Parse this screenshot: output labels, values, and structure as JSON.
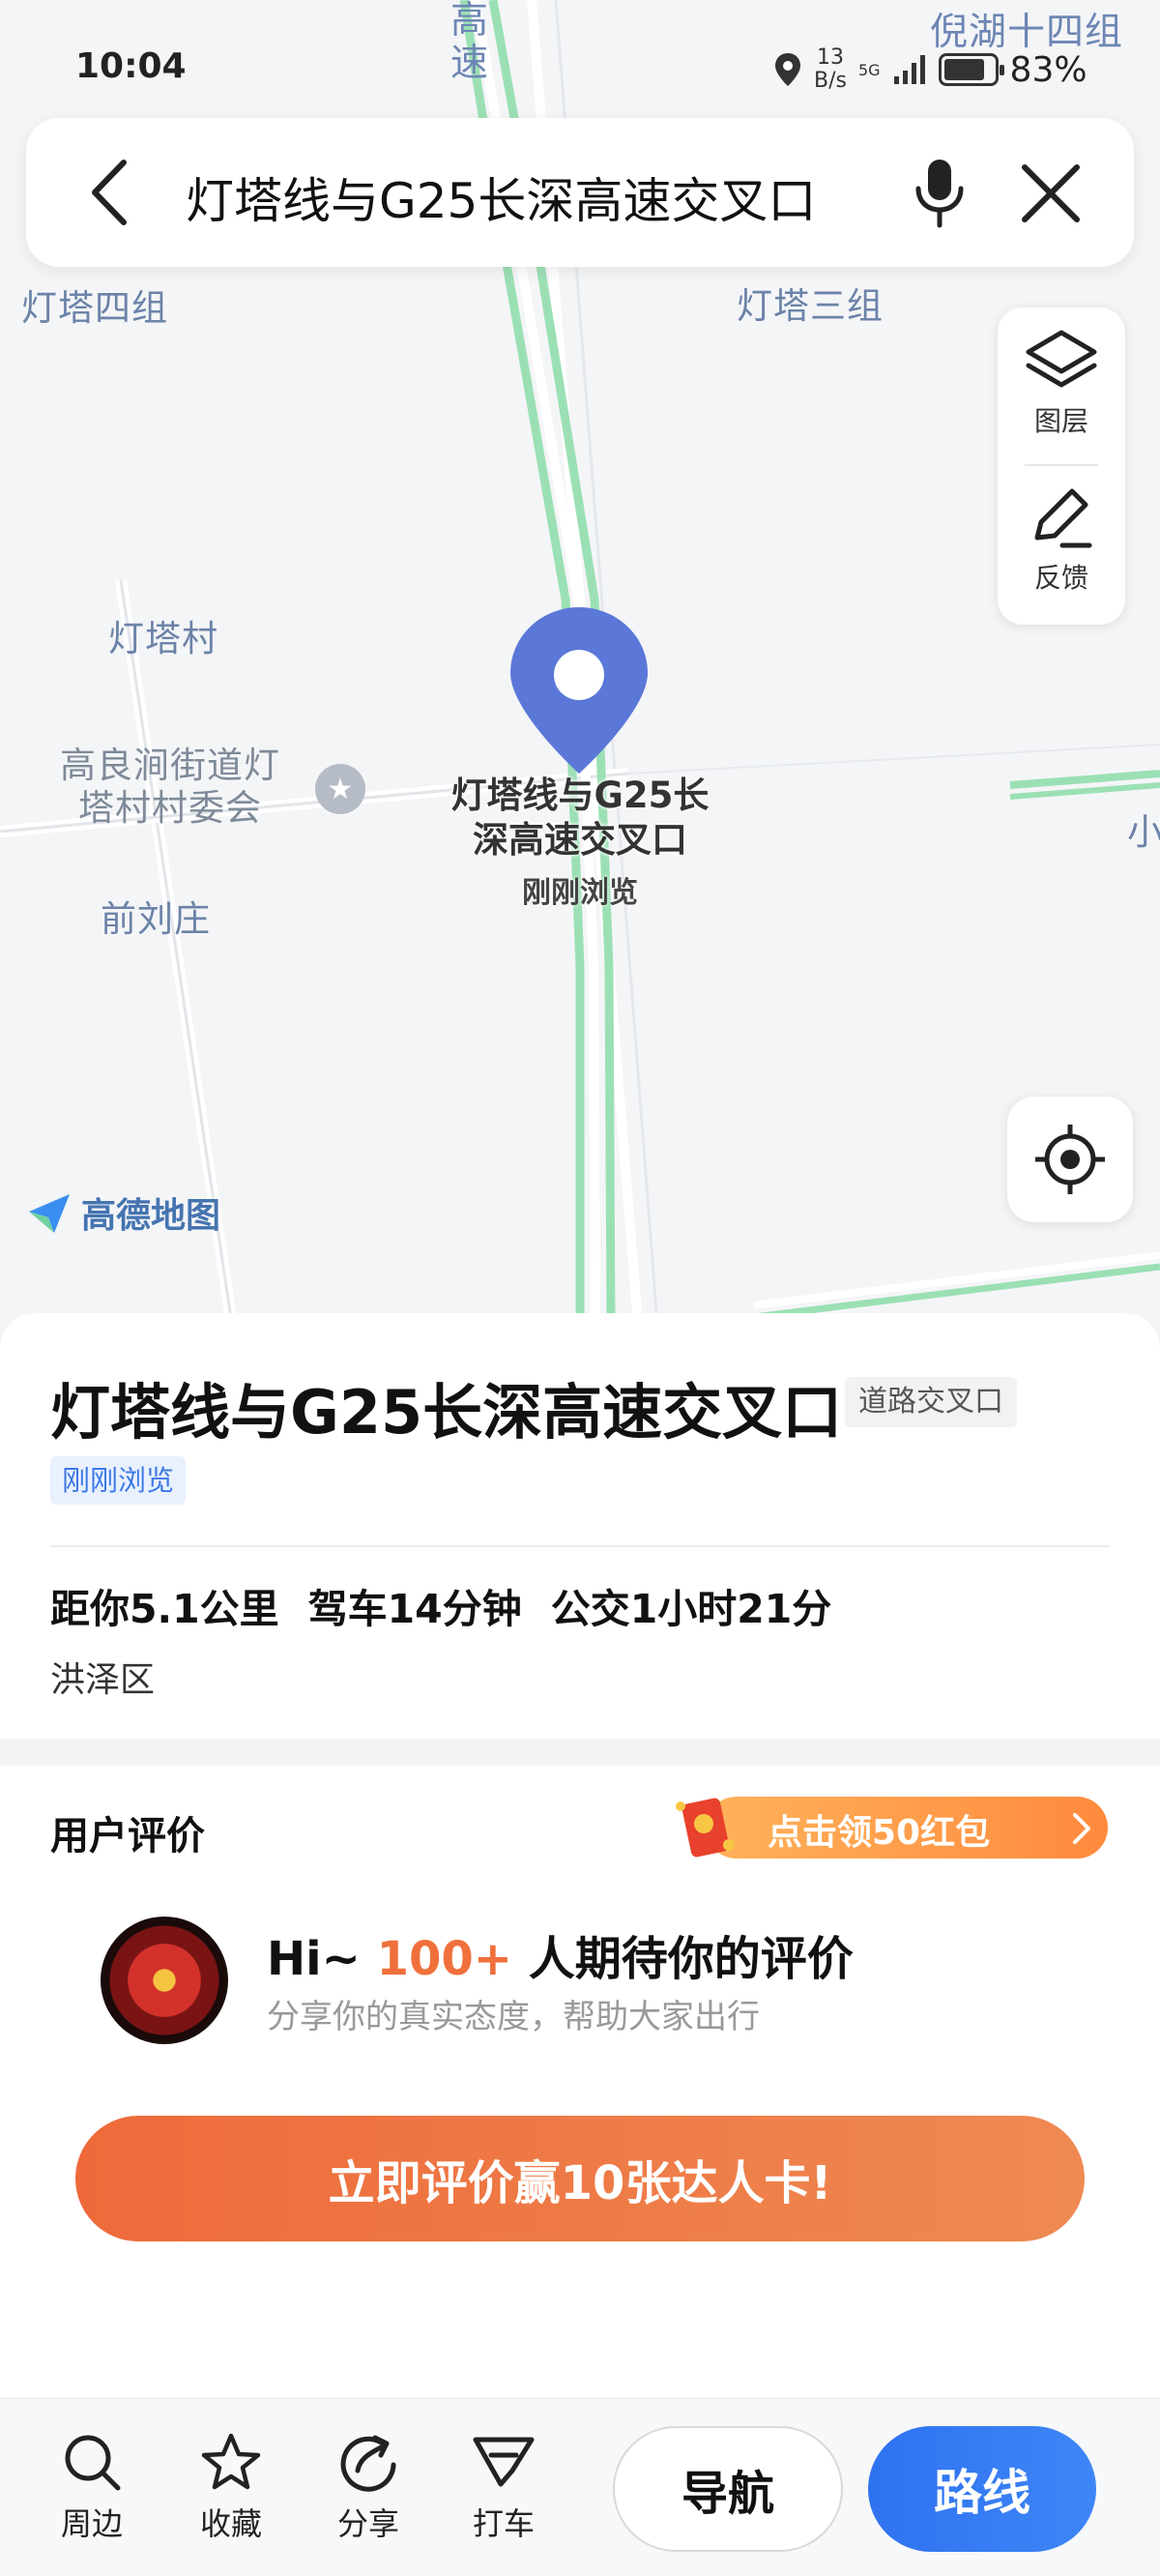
{
  "status_bar": {
    "time": "10:04",
    "net_speed_value": "13",
    "net_speed_unit": "B/s",
    "signal": "5G",
    "battery": "83%",
    "battery_level": 0.83
  },
  "search": {
    "query": "灯塔线与G25长深高速交叉口"
  },
  "map": {
    "labels": {
      "top_road": "高\n速",
      "ni_hu": "倪湖十四组",
      "dengta_4": "灯塔四组",
      "dengta_3": "灯塔三组",
      "dengta_village": "灯塔村",
      "committee": "高良涧街道灯\n塔村村委会",
      "qianliuzhuang": "前刘庄",
      "xiao": "小"
    },
    "poi_name": "灯塔线与G25长\n深高速交叉口",
    "poi_status": "刚刚浏览",
    "brand": "高德地图",
    "tools": {
      "layers": "图层",
      "feedback": "反馈"
    },
    "colors": {
      "road_green": "#9be0b4",
      "pin": "#5b78d8"
    }
  },
  "place": {
    "title": "灯塔线与G25长深高速交叉口",
    "type": "道路交叉口",
    "recent": "刚刚浏览",
    "distance": "距你5.1公里",
    "drive": "驾车14分钟",
    "transit": "公交1小时21分",
    "district": "洪泽区"
  },
  "reviews": {
    "title": "用户评价",
    "promo": "点击领50红包",
    "headline_prefix": "Hi~ ",
    "headline_count": "100+",
    "headline_suffix": " 人期待你的评价",
    "subtitle": "分享你的真实态度，帮助大家出行",
    "button": "立即评价赢10张达人卡!"
  },
  "bottom_bar": {
    "nearby": "周边",
    "favorite": "收藏",
    "share": "分享",
    "taxi": "打车",
    "navigate": "导航",
    "route": "路线"
  }
}
